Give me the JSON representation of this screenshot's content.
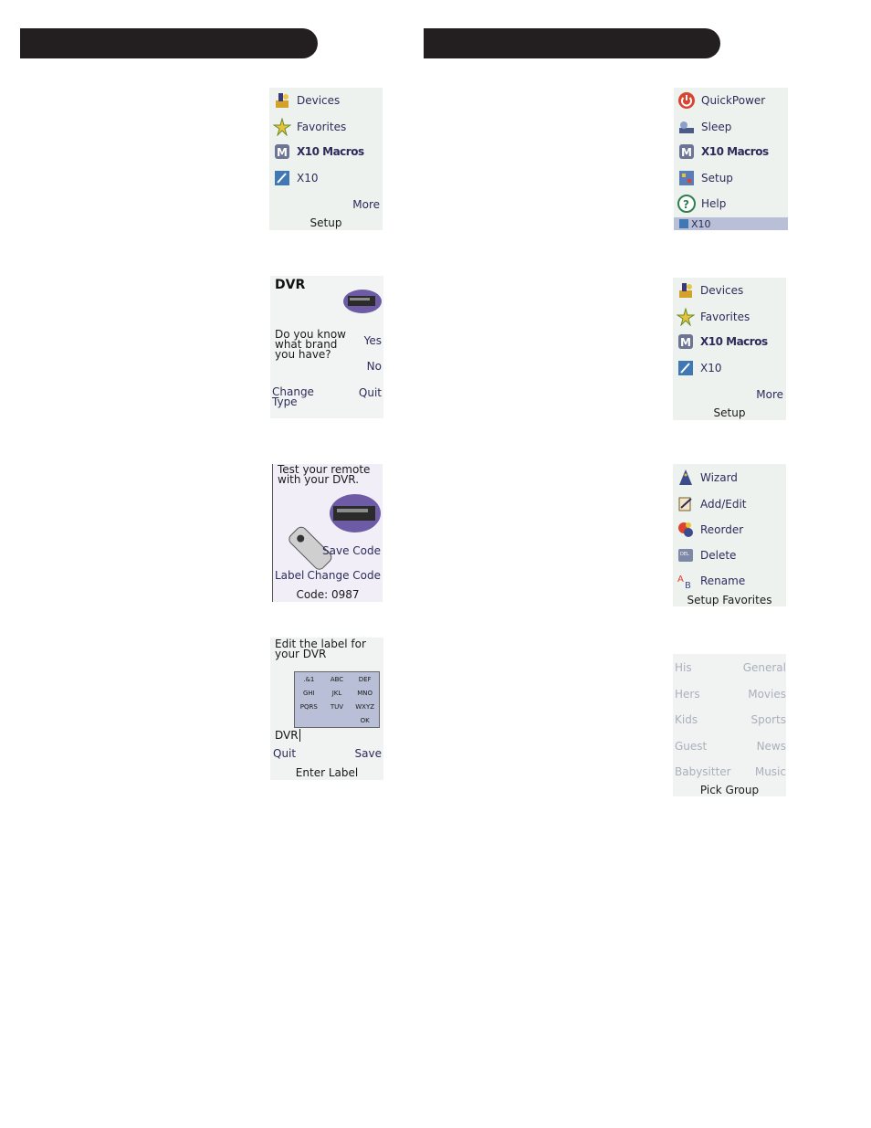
{
  "headers": {
    "left": "",
    "right": ""
  },
  "screen_devices_1": {
    "items": [
      {
        "label": "Devices",
        "icon": "devices-icon"
      },
      {
        "label": "Favorites",
        "icon": "favorites-icon"
      },
      {
        "label": "X10 Macros",
        "icon": "x10-macros-icon"
      },
      {
        "label": "X10",
        "icon": "x10-icon"
      }
    ],
    "more": "More",
    "caption": "Setup"
  },
  "screen_dvr_brand": {
    "title": "DVR",
    "question": "Do you know what brand you have?",
    "yes": "Yes",
    "no": "No",
    "change_type": "Change Type",
    "quit": "Quit"
  },
  "screen_test_remote": {
    "prompt": "Test your remote with your DVR.",
    "save_code": "Save Code",
    "label": "Label",
    "change_code": "Change Code",
    "code": "Code: 0987"
  },
  "screen_edit_label": {
    "prompt": "Edit the label for your DVR",
    "keypad": [
      ".&1",
      "ABC",
      "DEF",
      "GHI",
      "JKL",
      "MNO",
      "PQRS",
      "TUV",
      "WXYZ",
      "",
      "",
      "OK"
    ],
    "value": "DVR",
    "quit": "Quit",
    "save": "Save",
    "caption": "Enter Label"
  },
  "screen_quickpower": {
    "items": [
      {
        "label": "QuickPower",
        "icon": "power-icon"
      },
      {
        "label": "Sleep",
        "icon": "sleep-icon"
      },
      {
        "label": "X10 Macros",
        "icon": "x10-macros-icon"
      },
      {
        "label": "Setup",
        "icon": "setup-icon"
      },
      {
        "label": "Help",
        "icon": "help-icon"
      }
    ],
    "selected_bar": "X10"
  },
  "screen_devices_2": {
    "items": [
      {
        "label": "Devices",
        "icon": "devices-icon"
      },
      {
        "label": "Favorites",
        "icon": "favorites-icon"
      },
      {
        "label": "X10 Macros",
        "icon": "x10-macros-icon"
      },
      {
        "label": "X10",
        "icon": "x10-icon"
      }
    ],
    "more": "More",
    "caption": "Setup"
  },
  "screen_setup_favorites": {
    "items": [
      {
        "label": "Wizard",
        "icon": "wizard-icon"
      },
      {
        "label": "Add/Edit",
        "icon": "add-edit-icon"
      },
      {
        "label": "Reorder",
        "icon": "reorder-icon"
      },
      {
        "label": "Delete",
        "icon": "delete-icon"
      },
      {
        "label": "Rename",
        "icon": "rename-icon"
      }
    ],
    "caption": "Setup Favorites"
  },
  "screen_pick_group": {
    "left": [
      "His",
      "Hers",
      "Kids",
      "Guest",
      "Babysitter"
    ],
    "right": [
      "General",
      "Movies",
      "Sports",
      "News",
      "Music"
    ],
    "caption": "Pick Group"
  },
  "colors": {
    "header": "#231f20",
    "screen_bg": "#eef2ef",
    "menu_text": "#2c2c5a",
    "selected_bar": "#b9bfd6"
  }
}
